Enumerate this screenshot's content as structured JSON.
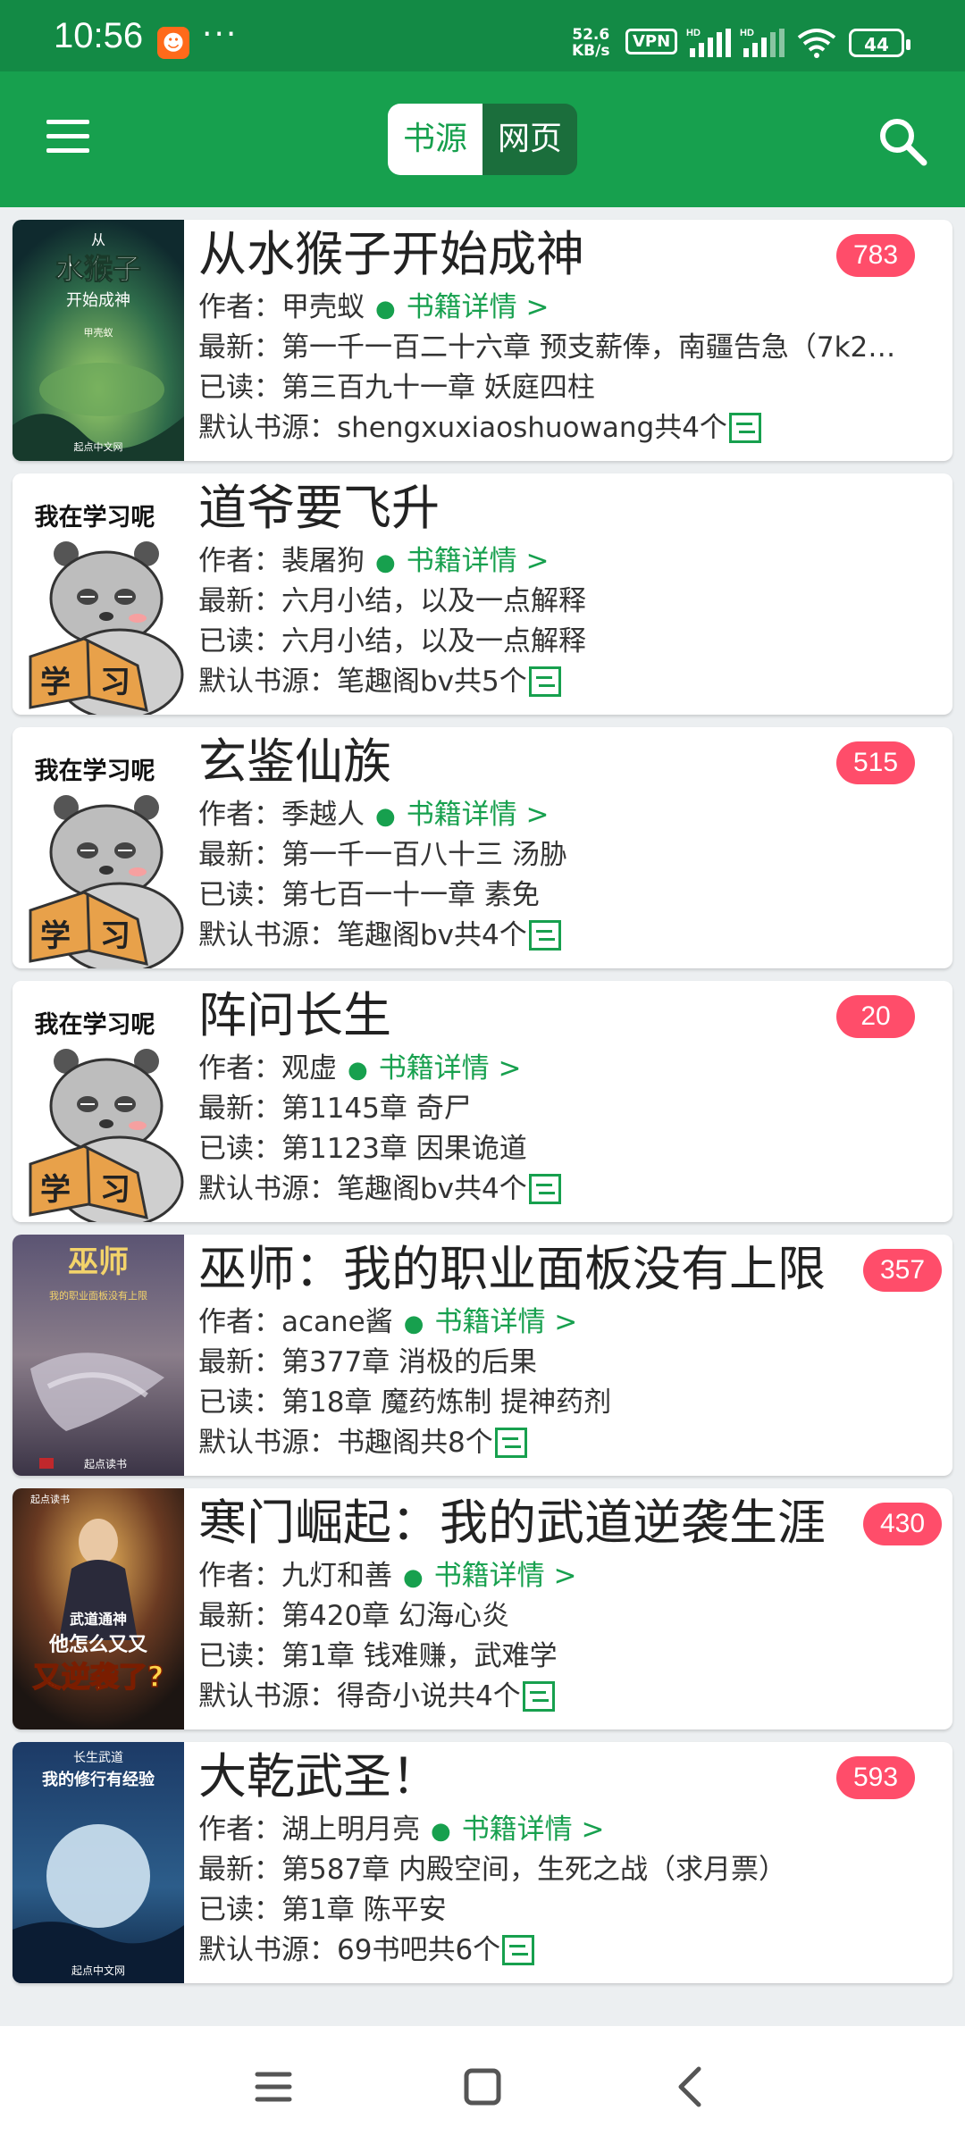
{
  "status_bar": {
    "time": "10:56",
    "more": "···",
    "speed_value": "52.6",
    "speed_unit": "KB/s",
    "vpn": "VPN",
    "battery": "44"
  },
  "header": {
    "tabs": [
      {
        "label": "书源",
        "active": true
      },
      {
        "label": "网页",
        "active": false
      }
    ]
  },
  "labels": {
    "author_prefix": "作者：",
    "latest_prefix": "最新：",
    "read_prefix": "已读：",
    "source_prefix": "默认书源：",
    "detail_link": "书籍详情 >"
  },
  "books": [
    {
      "title": "从水猴子开始成神",
      "badge": "783",
      "author": "甲壳蚁",
      "latest": "第一千一百二十六章 预支薪俸，南疆告急（7k2…",
      "read": "第三百九十一章 妖庭四柱",
      "source": "shengxuxiaoshuowang共4个",
      "cover": "shuihouzi",
      "cover_text": [
        "从",
        "水猴子",
        "开始成神",
        "甲壳蚁",
        "起点中文网"
      ]
    },
    {
      "title": "道爷要飞升",
      "badge": "",
      "author": "裴屠狗",
      "latest": "六月小结，以及一点解释",
      "read": "六月小结，以及一点解释",
      "source": "笔趣阁bv共5个",
      "cover": "panda",
      "cover_text": [
        "我在学习呢",
        "学",
        "习"
      ]
    },
    {
      "title": "玄鉴仙族",
      "badge": "515",
      "author": "季越人",
      "latest": "第一千一百八十三 汤胁",
      "read": "第七百一十一章 素免",
      "source": "笔趣阁bv共4个",
      "cover": "panda",
      "cover_text": [
        "我在学习呢",
        "学",
        "习"
      ]
    },
    {
      "title": "阵问长生",
      "badge": "20",
      "author": "观虚",
      "latest": "第1145章 奇尸",
      "read": "第1123章 因果诡道",
      "source": "笔趣阁bv共4个",
      "cover": "panda",
      "cover_text": [
        "我在学习呢",
        "学",
        "习"
      ]
    },
    {
      "title": "巫师：我的职业面板没有上限",
      "badge": "357",
      "author": "acane酱",
      "latest": "第377章 消极的后果",
      "read": "第18章 魔药炼制 提神药剂",
      "source": "书趣阁共8个",
      "cover": "wushi",
      "cover_text": [
        "巫师",
        "我的职业面板没有上限",
        "起点读书"
      ]
    },
    {
      "title": "寒门崛起：我的武道逆袭生涯",
      "badge": "430",
      "author": "九灯和善",
      "latest": "第420章 幻海心炎",
      "read": "第1章 钱难赚，武难学",
      "source": "得奇小说共4个",
      "cover": "hanmen",
      "cover_text": [
        "起点读书",
        "武道通神",
        "他怎么又又",
        "又逆袭了?"
      ]
    },
    {
      "title": "大乾武圣！",
      "badge": "593",
      "author": "湖上明月亮",
      "latest": "第587章 内殿空间，生死之战（求月票）",
      "read": "第1章 陈平安",
      "source": "69书吧共6个",
      "cover": "daqian",
      "cover_text": [
        "长生武道",
        "我的修行有经验",
        "起点中文网"
      ]
    }
  ],
  "colors": {
    "status_bar": "#138a45",
    "app_bar": "#17a04e",
    "accent": "#17a04e",
    "badge": "#ff4d6a",
    "background": "#eceff1"
  },
  "icons": {
    "menu": "hamburger-icon",
    "search": "search-icon",
    "source": "source-switch-icon",
    "nav_recents": "recents-icon",
    "nav_home": "home-icon",
    "nav_back": "back-icon"
  }
}
